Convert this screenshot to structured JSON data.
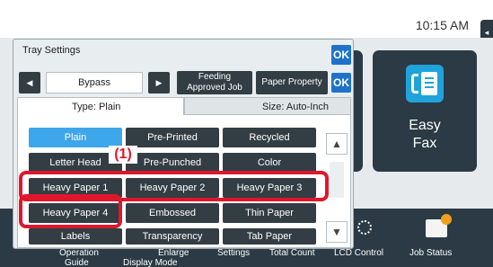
{
  "clock": "10:15 AM",
  "home": {
    "easy_fax_line1": "Easy",
    "easy_fax_line2": "Fax"
  },
  "bottom_bar": {
    "operation_guide_1": "Operation",
    "operation_guide_2": "Guide",
    "enlarge_1": "Enlarge",
    "enlarge_2": "Display Mode",
    "settings": "Settings",
    "total_count": "Total Count",
    "lcd_control": "LCD Control",
    "job_status": "Job Status"
  },
  "dialog": {
    "title": "Tray Settings",
    "ok": "OK",
    "tray_name": "Bypass",
    "feeding_approved_1": "Feeding",
    "feeding_approved_2": "Approved Job",
    "paper_property": "Paper Property",
    "type_tab": "Type:   Plain",
    "size_tab": "Size:   Auto-Inch",
    "paper_types": [
      "Plain",
      "Pre-Printed",
      "Recycled",
      "Letter Head",
      "Pre-Punched",
      "Color",
      "Heavy Paper 1",
      "Heavy Paper 2",
      "Heavy Paper 3",
      "Heavy Paper 4",
      "Embossed",
      "Thin Paper",
      "Labels",
      "Transparency",
      "Tab Paper"
    ],
    "selected_type": "Plain",
    "marker": "(1)"
  },
  "icons": [
    "left-arrow-icon",
    "right-arrow-icon",
    "scroll-up-icon",
    "scroll-down-icon",
    "easy-fax-icon",
    "brightness-icon",
    "job-status-icon"
  ],
  "colors": {
    "accent": "#1e73c9",
    "selected": "#3ea6ea",
    "highlight": "#e0162b",
    "button": "#333d44"
  }
}
